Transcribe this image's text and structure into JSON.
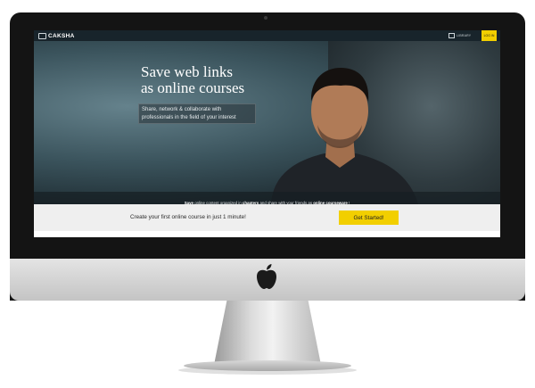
{
  "navbar": {
    "logo_text": "CAKSHA",
    "library_label": "LIBRARY",
    "login_label": "LOG IN"
  },
  "hero": {
    "headline_line1": "Save web links",
    "headline_line2": "as online courses",
    "subtext": "Share, network & collaborate with professionals in the field of your interest",
    "strip": {
      "p1": "Save",
      "p2": " online content organized in ",
      "p3": "chapters",
      "p4": " and share with your friends as ",
      "p5": "online courseware",
      "p6": " !"
    }
  },
  "cta": {
    "text": "Create your first online course in just 1 minute!",
    "button_label": "Get Started!"
  },
  "colors": {
    "accent": "#f2cf00",
    "navbar": "#18242b"
  }
}
